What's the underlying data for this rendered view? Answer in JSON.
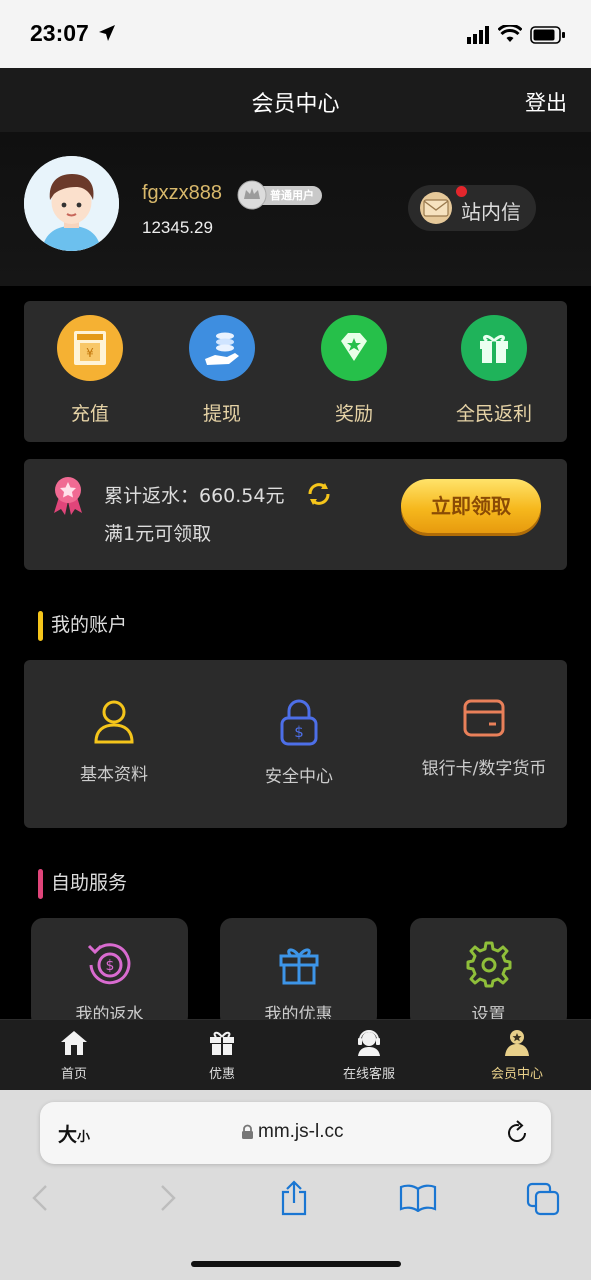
{
  "status_bar": {
    "time": "23:07"
  },
  "header": {
    "title": "会员中心",
    "logout_label": "登出"
  },
  "profile": {
    "username": "fgxzx888",
    "badge_label": "普通用户",
    "balance": "12345.29",
    "inbox_label": "站内信"
  },
  "quick_actions": [
    {
      "label": "充值",
      "icon": "atm-card-icon",
      "color": "#f5b133"
    },
    {
      "label": "提现",
      "icon": "coin-hand-icon",
      "color": "#3e8ee0"
    },
    {
      "label": "奖励",
      "icon": "diamond-icon",
      "color": "#26c04a"
    },
    {
      "label": "全民返利",
      "icon": "gift-icon",
      "color": "#1fb35a"
    }
  ],
  "rebate": {
    "total_label": "累计返水：660.54元",
    "min_label": "满1元可领取",
    "claim_button": "立即领取"
  },
  "account_section": {
    "title": "我的账户",
    "items": [
      {
        "label": "基本资料",
        "icon": "user-icon"
      },
      {
        "label": "安全中心",
        "icon": "lock-icon"
      },
      {
        "label": "银行卡/数字货币",
        "icon": "card-icon"
      }
    ]
  },
  "service_section": {
    "title": "自助服务",
    "items": [
      {
        "label": "我的返水",
        "icon": "rebate-dollar-icon"
      },
      {
        "label": "我的优惠",
        "icon": "gift-icon"
      },
      {
        "label": "设置",
        "icon": "gear-icon"
      }
    ]
  },
  "tab_bar": [
    {
      "label": "首页",
      "icon": "home-icon"
    },
    {
      "label": "优惠",
      "icon": "gift-icon"
    },
    {
      "label": "在线客服",
      "icon": "headset-icon"
    },
    {
      "label": "会员中心",
      "icon": "member-icon",
      "active": true
    }
  ],
  "browser": {
    "text_size_label": "大",
    "text_size_small": "小",
    "url": "mm.js-l.cc"
  },
  "colors": {
    "gold_text": "#d8b86b",
    "accent_yellow": "#f5c51b",
    "accent_pink": "#e0457a",
    "card_bg": "#2b2b2b"
  }
}
